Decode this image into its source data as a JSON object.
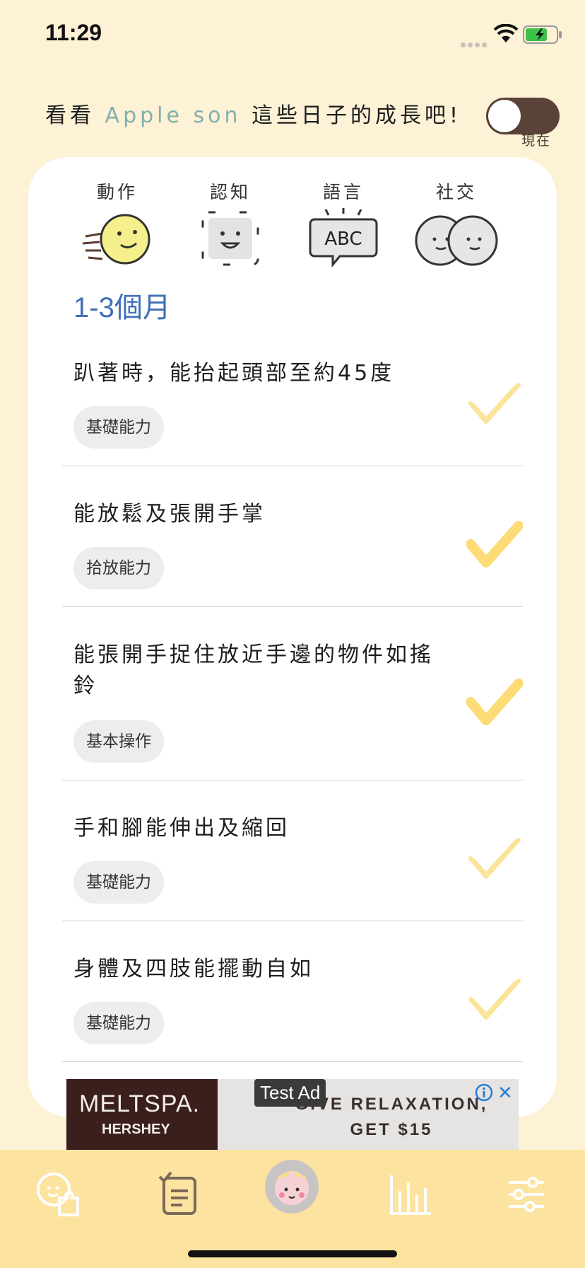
{
  "status_bar": {
    "time": "11:29"
  },
  "header": {
    "prefix": "看看",
    "child_name": "Apple son",
    "suffix": "這些日子的成長吧!",
    "toggle_label": "現在"
  },
  "categories": [
    {
      "label": "動作",
      "icon": "motion-face-icon"
    },
    {
      "label": "認知",
      "icon": "cognition-face-icon"
    },
    {
      "label": "語言",
      "icon": "abc-speech-icon"
    },
    {
      "label": "社交",
      "icon": "two-faces-icon"
    }
  ],
  "age_range": "1-3個月",
  "milestones": [
    {
      "text": "趴著時，能抬起頭部至約45度",
      "tag": "基礎能力",
      "checked": false
    },
    {
      "text": "能放鬆及張開手掌",
      "tag": "拾放能力",
      "checked": true
    },
    {
      "text": "能張開手捉住放近手邊的物件如搖鈴",
      "tag": "基本操作",
      "checked": true
    },
    {
      "text": "手和腳能伸出及縮回",
      "tag": "基礎能力",
      "checked": false
    },
    {
      "text": "身體及四肢能擺動自如",
      "tag": "基礎能力",
      "checked": false
    }
  ],
  "ad": {
    "badge": "Test Ad",
    "brand": "MELTSPA.",
    "brand_sub": "HERSHEY",
    "text_line1": "GIVE RELAXATION,",
    "text_line2": "GET $15",
    "close": "✕"
  },
  "tabs": [
    {
      "icon": "puzzle-face-icon"
    },
    {
      "icon": "checklist-icon"
    },
    {
      "icon": "baby-avatar-icon"
    },
    {
      "icon": "bar-chart-icon"
    },
    {
      "icon": "settings-sliders-icon"
    }
  ],
  "colors": {
    "background": "#fdf1d6",
    "tabbar": "#fde3a0",
    "check_active": "#fddc78",
    "check_inactive": "#fbe7a6",
    "age_range": "#3f6fb6",
    "name": "#7fb0ae"
  }
}
